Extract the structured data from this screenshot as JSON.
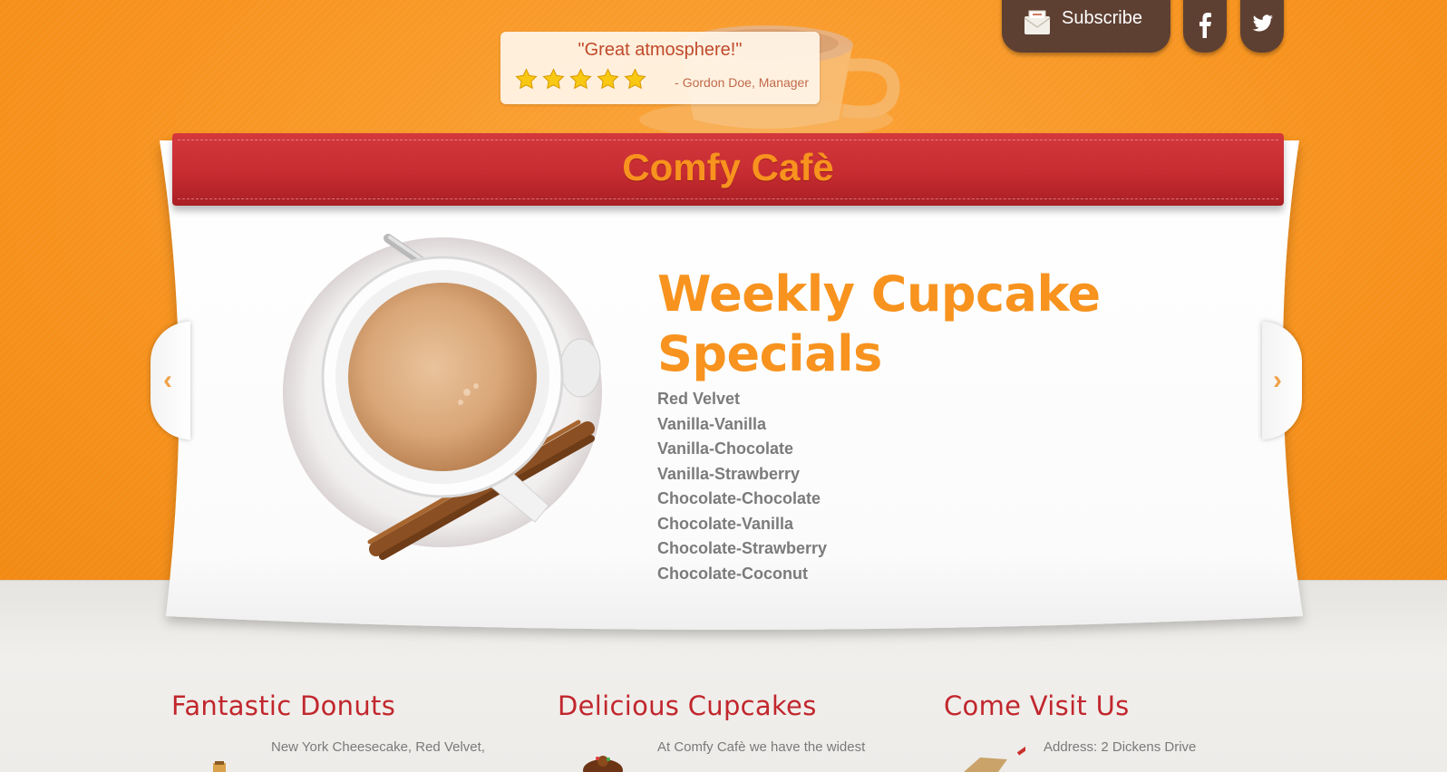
{
  "header": {
    "subscribe_label": "Subscribe",
    "social": [
      {
        "name": "facebook-icon"
      },
      {
        "name": "twitter-icon"
      }
    ]
  },
  "testimonial": {
    "quote": "\"Great atmosphere!\"",
    "rating": 5,
    "rating_max": 5,
    "author": "- Gordon Doe, Manager"
  },
  "site": {
    "title": "Comfy Cafè"
  },
  "slider": {
    "prev_arrow": "‹",
    "next_arrow": "›",
    "heading": "Weekly Cupcake Specials",
    "items": [
      "Red Velvet",
      "Vanilla-Vanilla",
      "Vanilla-Chocolate",
      "Vanilla-Strawberry",
      "Chocolate-Chocolate",
      "Chocolate-Vanilla",
      "Chocolate-Strawberry",
      "Chocolate-Coconut"
    ]
  },
  "columns": [
    {
      "title": "Fantastic Donuts",
      "text": "New York Cheesecake, Red Velvet,"
    },
    {
      "title": "Delicious Cupcakes",
      "text": "At Comfy Cafè we have the widest"
    },
    {
      "title": "Come Visit Us",
      "text": "Address: 2 Dickens Drive"
    }
  ],
  "colors": {
    "accent_orange": "#f7931e",
    "ribbon_red": "#c62c31",
    "brown": "#5e4033",
    "heading_red": "#c1272d"
  }
}
